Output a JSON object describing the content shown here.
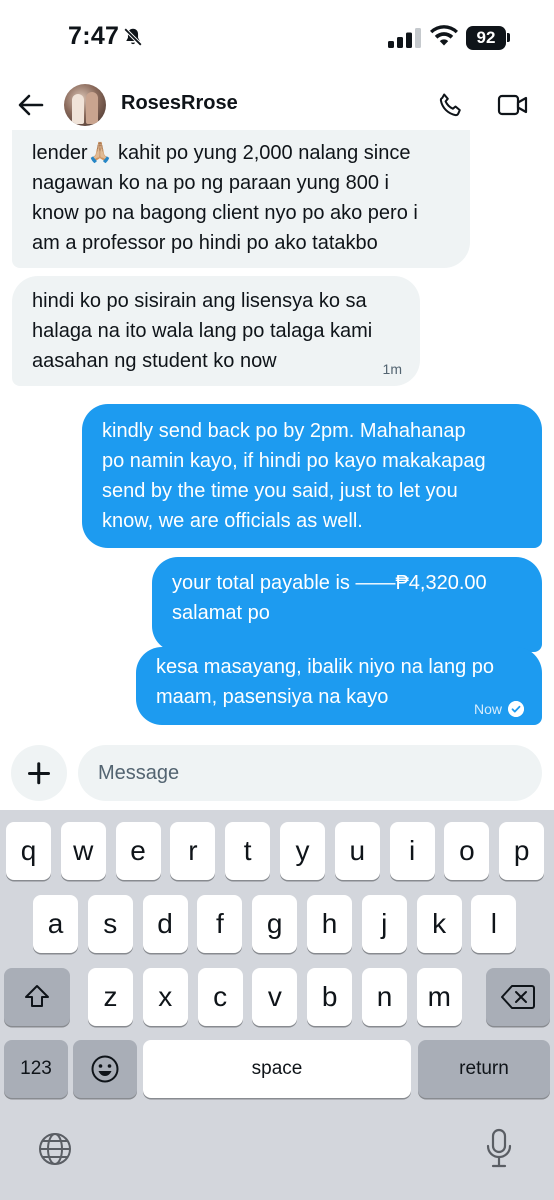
{
  "status_bar": {
    "time": "7:47",
    "battery": "92"
  },
  "header": {
    "contact_name": "RosesRrose"
  },
  "messages": [
    {
      "direction": "incoming",
      "text": "lender🙏🏼 kahit po yung 2,000 nalang since\nnagawan ko na po ng paraan yung 800 i\nknow po na bagong client nyo po ako pero i\nam a professor po hindi po ako tatakbo"
    },
    {
      "direction": "incoming",
      "text": "hindi ko po sisirain ang lisensya ko sa\nhalaga na ito wala lang po talaga kami\naasahan ng student ko now",
      "time": "1m"
    },
    {
      "direction": "outgoing",
      "text": "kindly send back po by 2pm. Mahahanap\npo namin kayo, if hindi po kayo makakapag\nsend by the time you said, just to let you\nknow, we are officials as well."
    },
    {
      "direction": "outgoing",
      "text": "your total payable is ——₱4,320.00\nsalamat po"
    },
    {
      "direction": "outgoing",
      "text": "kesa masayang, ibalik niyo na lang po\nmaam, pasensiya na kayo",
      "time": "Now"
    }
  ],
  "composer": {
    "placeholder": "Message"
  },
  "keyboard": {
    "row1": [
      "q",
      "w",
      "e",
      "r",
      "t",
      "y",
      "u",
      "i",
      "o",
      "p"
    ],
    "row2": [
      "a",
      "s",
      "d",
      "f",
      "g",
      "h",
      "j",
      "k",
      "l"
    ],
    "row3": [
      "z",
      "x",
      "c",
      "v",
      "b",
      "n",
      "m"
    ],
    "numbers_label": "123",
    "space_label": "space",
    "return_label": "return"
  },
  "colors": {
    "accent": "#1d9bf0",
    "incoming_bubble": "#eff3f4",
    "keyboard_bg": "#d3d6dc"
  }
}
